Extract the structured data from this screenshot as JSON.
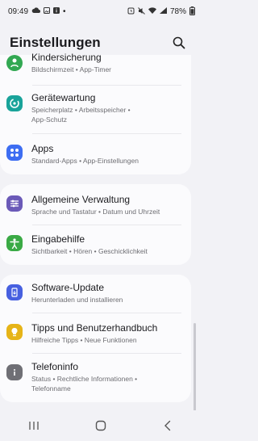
{
  "status_bar": {
    "time": "09:49",
    "battery": "78%",
    "dot": "•"
  },
  "header": {
    "title": "Einstellungen",
    "search_icon": "search-icon"
  },
  "groups": [
    {
      "items": [
        {
          "title": "Kindersicherung",
          "subtitle": "Bildschirmzeit  •  App-Timer",
          "icon": "child-icon",
          "color": "#32a852"
        },
        {
          "title": "Gerätewartung",
          "subtitle": "Speicherplatz  •  Arbeitsspeicher  •",
          "subtitle2": "App-Schutz",
          "icon": "maintenance-icon",
          "color": "#19a39a"
        },
        {
          "title": "Apps",
          "subtitle": "Standard-Apps  •  App-Einstellungen",
          "icon": "apps-icon",
          "color": "#3d6df2"
        }
      ]
    },
    {
      "items": [
        {
          "title": "Allgemeine Verwaltung",
          "subtitle": "Sprache und Tastatur  •  Datum und Uhrzeit",
          "icon": "sliders-icon",
          "color": "#6b5ab8"
        },
        {
          "title": "Eingabehilfe",
          "subtitle": "Sichtbarkeit  •  Hören  •  Geschicklichkeit",
          "icon": "accessibility-icon",
          "color": "#3aaa45"
        }
      ]
    },
    {
      "items": [
        {
          "title": "Software-Update",
          "subtitle": "Herunterladen und installieren",
          "icon": "update-icon",
          "color": "#4760e0"
        },
        {
          "title": "Tipps und Benutzerhandbuch",
          "subtitle": "Hilfreiche Tipps  •  Neue Funktionen",
          "icon": "tips-icon",
          "color": "#e6b418"
        },
        {
          "title": "Telefoninfo",
          "subtitle": "Status  •  Rechtliche Informationen  •",
          "subtitle2": "Telefonname",
          "icon": "info-icon",
          "color": "#6f6f75"
        }
      ]
    }
  ],
  "nav": {
    "recent": "recents-icon",
    "home": "home-icon",
    "back": "back-icon"
  }
}
